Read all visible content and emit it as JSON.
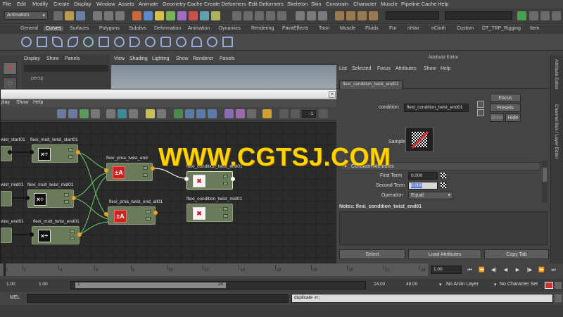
{
  "menubar": [
    "File",
    "Edit",
    "Modify",
    "Create",
    "Display",
    "Window",
    "Assets",
    "Animate",
    "Geometry Cache",
    "Create Deformers",
    "Edit Deformers",
    "Skeleton",
    "Skin",
    "Constrain",
    "Character",
    "Muscle",
    "Pipeline Cache",
    "Help"
  ],
  "toolbar": {
    "mode_select": "Animation"
  },
  "shelf_tabs": [
    {
      "label": "General",
      "active": false
    },
    {
      "label": "Curves",
      "active": true
    },
    {
      "label": "Surfaces",
      "active": false
    },
    {
      "label": "Polygons",
      "active": false
    },
    {
      "label": "Subdivs",
      "active": false
    },
    {
      "label": "Deformation",
      "active": false
    },
    {
      "label": "Animation",
      "active": false
    },
    {
      "label": "Dynamics",
      "active": false
    },
    {
      "label": "Rendering",
      "active": false
    },
    {
      "label": "PaintEffects",
      "active": false
    },
    {
      "label": "Toon",
      "active": false
    },
    {
      "label": "Muscle",
      "active": false
    },
    {
      "label": "Fluids",
      "active": false
    },
    {
      "label": "Fur",
      "active": false
    },
    {
      "label": "nHair",
      "active": false
    },
    {
      "label": "nCloth",
      "active": false
    },
    {
      "label": "Custom",
      "active": false
    },
    {
      "label": "DT_TRP_Rigging",
      "active": false
    },
    {
      "label": "Item",
      "active": false
    }
  ],
  "outliner": {
    "menu": [
      "Display",
      "Show",
      "Panels"
    ],
    "item": "persp"
  },
  "viewport": {
    "menu": [
      "View",
      "Shading",
      "Lighting",
      "Show",
      "Renderer",
      "Panels"
    ]
  },
  "node_editor": {
    "menu": [
      "play",
      "Show",
      "Help"
    ],
    "field_value": "-1",
    "nodes": [
      {
        "label": "flexi_mult_twist_start01",
        "symbol": "×÷"
      },
      {
        "label": "flexi_mult_twist_mid01",
        "symbol": "×÷"
      },
      {
        "label": "flexi_mult_twist_end01",
        "symbol": "×÷"
      },
      {
        "label": "flexi_pma_twist_end",
        "symbol": "±A"
      },
      {
        "label": "flexi_pma_twist_end_all01",
        "symbol": "±A"
      },
      {
        "label": "flexi_condition_twist_end01",
        "symbol": "✖"
      },
      {
        "label": "flexi_condition_twist_mid01",
        "symbol": "✖"
      }
    ],
    "cut_labels": [
      "wist_start01",
      "wist_mid01",
      "wist_end01"
    ]
  },
  "attribute_editor": {
    "title": "Attribute Editor",
    "menu": [
      "List",
      "Selected",
      "Focus",
      "Attributes",
      "Show",
      "Help"
    ],
    "tab": "flexi_condition_twist_end01",
    "condition_label": "condition:",
    "condition_value": "flexi_condition_twist_end01",
    "focus_button": "Focus",
    "presets_button": "Presets",
    "show_button": "Show",
    "hide_button": "Hide",
    "sample_label": "Sample",
    "section_title": "Condition Attributes",
    "first_term_label": "First Term",
    "first_term_value": "0.000",
    "second_term_label": "Second Term",
    "second_term_value": "0.000",
    "operation_label": "Operation",
    "operation_value": "Equal",
    "notes": "Notes: flexi_condition_twist_end01",
    "select_button": "Select",
    "load_button": "Load Attributes",
    "copy_button": "Copy Tab"
  },
  "side_tabs": [
    "Attribute Editor",
    "Channel Box / Layer Editor"
  ],
  "time_slider": {
    "ticks": [
      "1",
      "2",
      "4",
      "6",
      "8",
      "10",
      "12",
      "14",
      "16",
      "18",
      "20",
      "22",
      "24"
    ],
    "current_frame": "1.00"
  },
  "range": {
    "start": "1.00",
    "inner_start": "1.00",
    "slider_start": "1",
    "slider_end": "24",
    "inner_end": "24.00",
    "end": "48.00",
    "anim_layer": "No Anim Layer",
    "character_set": "No Character Set"
  },
  "command_line": {
    "label": "MEL",
    "result": "duplicate -rr;"
  },
  "watermark": "WWW.CGTSJ.COM"
}
